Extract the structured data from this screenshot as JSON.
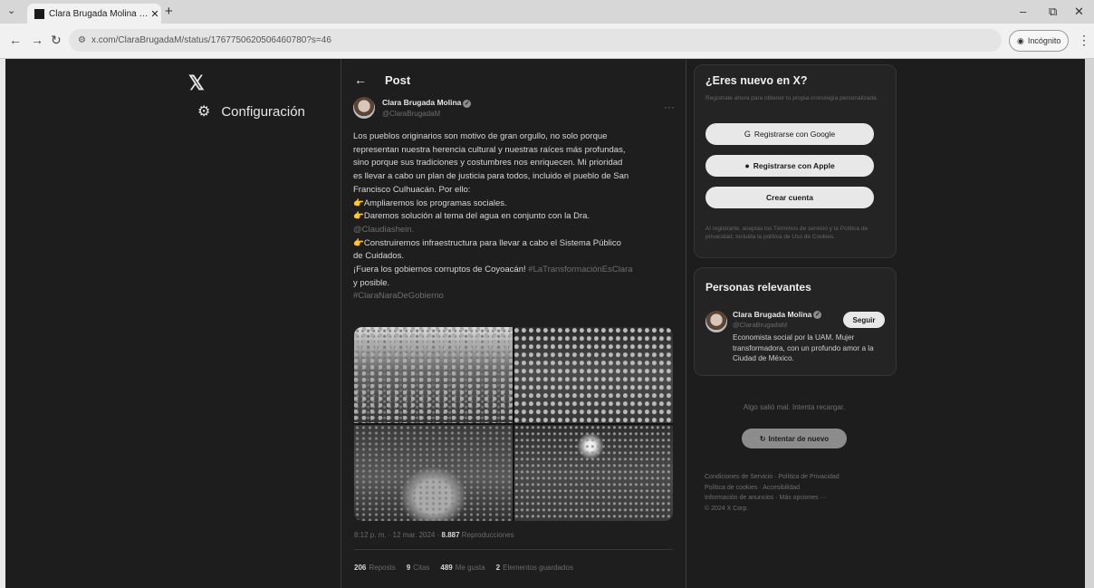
{
  "browser": {
    "tab_title": "Clara Brugada Molina en X: \"Lo",
    "url": "x.com/ClaraBrugadaM/status/1767750620506460780?s=46",
    "incognito_label": "Incógnito"
  },
  "sidebar": {
    "settings_label": "Configuración"
  },
  "post": {
    "header_title": "Post",
    "author_name": "Clara Brugada Molina",
    "author_handle": "@ClaraBrugadaM",
    "lines": [
      "Los pueblos originarios son motivo de gran orgullo, no solo porque",
      "representan nuestra herencia cultural y nuestras raíces más profundas,",
      "sino porque sus tradiciones y costumbres nos enriquecen. Mi prioridad",
      "es llevar a cabo un plan de justicia para todos, incluido el pueblo de San",
      "Francisco Culhuacán. Por ello:",
      "👉Ampliaremos los programas sociales.",
      "👉Daremos solución al tema del agua en conjunto con la Dra."
    ],
    "mention": "@Claudiashein.",
    "lines2": [
      "👉Construiremos infraestructura para llevar a cabo el Sistema Público",
      "de Cuidados."
    ],
    "line3": "¡Fuera los gobiernos corruptos de Coyoacán!",
    "hashtag1": "#LaTransformaciónEsClara",
    "line4": "y posible.",
    "hashtag2": "#ClaraNaraDeGobierno",
    "time": "8:12 p. m. · 12 mar. 2024 ·",
    "views_count": "8.887",
    "views_label": "Reproducciones",
    "reposts_count": "206",
    "reposts_label": "Reposts",
    "quotes_count": "9",
    "quotes_label": "Citas",
    "likes_count": "489",
    "likes_label": "Me gusta",
    "bookmarks_count": "2",
    "bookmarks_label": "Elementos guardados"
  },
  "signup": {
    "title": "¿Eres nuevo en X?",
    "subtitle": "Regístrate ahora para obtener tu propia cronología personalizada.",
    "google": "Registrarse con Google",
    "apple": "Registrarse con Apple",
    "create": "Crear cuenta",
    "legal": "Al registrarte, aceptas los Términos de servicio y la Política de privacidad, incluida la política de Uso de Cookies."
  },
  "relevant": {
    "title": "Personas relevantes",
    "name": "Clara Brugada Molina",
    "handle": "@ClaraBrugadaM",
    "follow": "Seguir",
    "bio": "Economista social por la UAM. Mujer transformadora, con un profundo amor a la Ciudad de México."
  },
  "error": {
    "message": "Algo salió mal. Intenta recargar.",
    "retry": "Intentar de nuevo"
  },
  "footer": {
    "links": [
      "Condiciones de Servicio · Política de Privacidad",
      "Política de cookies · Accesibilidad",
      "Información de anuncios · Más opciones ···",
      "© 2024 X Corp."
    ]
  }
}
